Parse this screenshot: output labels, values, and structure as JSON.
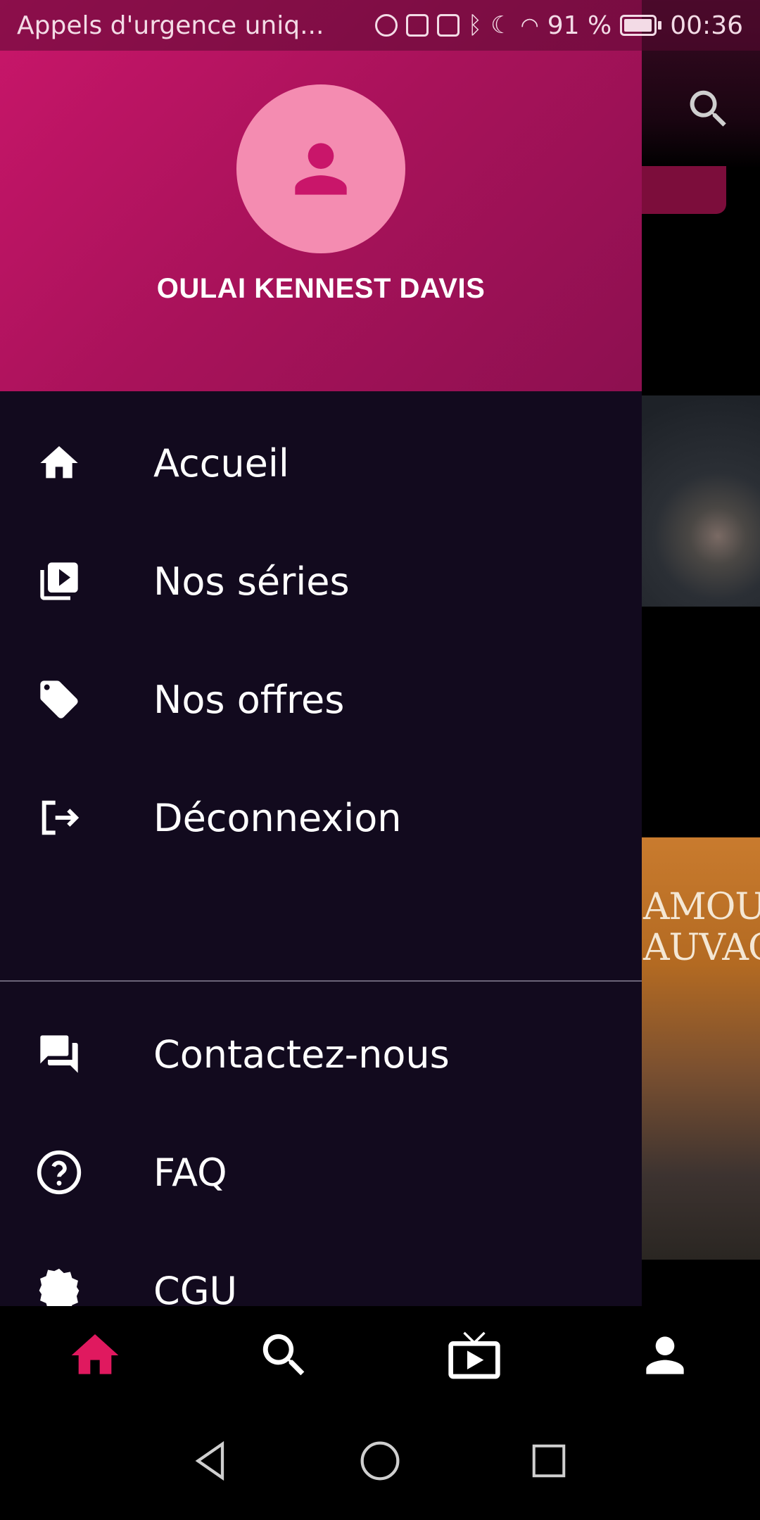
{
  "status_bar": {
    "carrier_text": "Appels d'urgence uniq...",
    "battery_percent": "91 %",
    "time": "00:36"
  },
  "drawer": {
    "user_name": "OULAI KENNEST DAVIS",
    "menu_primary": [
      {
        "label": "Accueil",
        "icon": "home-icon"
      },
      {
        "label": "Nos séries",
        "icon": "video-library-icon"
      },
      {
        "label": "Nos offres",
        "icon": "tag-icon"
      },
      {
        "label": "Déconnexion",
        "icon": "logout-icon"
      }
    ],
    "menu_secondary": [
      {
        "label": "Contactez-nous",
        "icon": "chat-icon"
      },
      {
        "label": "FAQ",
        "icon": "help-icon"
      },
      {
        "label": "CGU",
        "icon": "badge-icon"
      }
    ]
  },
  "background": {
    "poster_text": "AMOU\nAUVAG"
  },
  "bottom_nav": [
    {
      "name": "home",
      "icon": "home-icon",
      "active": true
    },
    {
      "name": "search",
      "icon": "search-icon",
      "active": false
    },
    {
      "name": "live",
      "icon": "live-tv-icon",
      "active": false
    },
    {
      "name": "profile",
      "icon": "person-icon",
      "active": false
    }
  ],
  "colors": {
    "accent": "#e0195f",
    "drawer_bg": "#120a1e",
    "header_gradient_start": "#c9166a",
    "header_gradient_end": "#8d1050",
    "avatar_bg": "#f48cb1"
  }
}
